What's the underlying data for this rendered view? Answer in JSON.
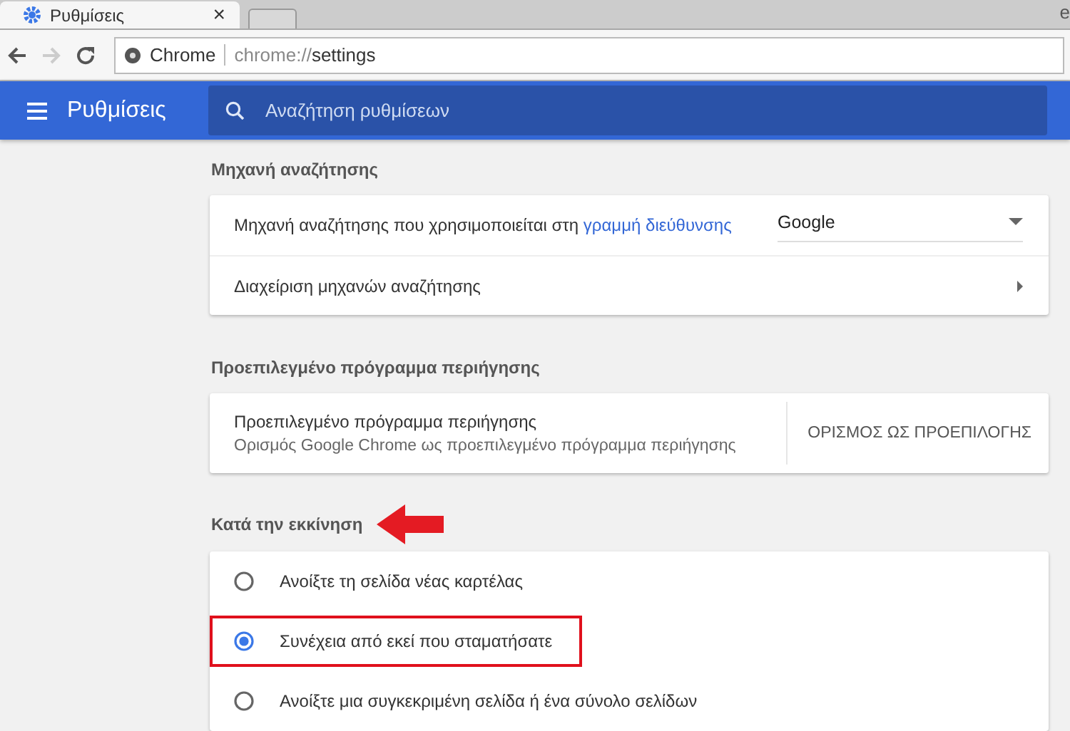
{
  "tabs": [
    {
      "title": "Ρυθμίσεις",
      "selected": true,
      "close": "×"
    },
    {
      "selected": false
    }
  ],
  "tabstrip_edge_text": "e",
  "address_bar": {
    "site": "Chrome",
    "url_scheme": "chrome://",
    "url_path": "settings"
  },
  "header": {
    "title": "Ρυθμίσεις",
    "search_placeholder": "Αναζήτηση ρυθμίσεων"
  },
  "sections": [
    {
      "title": "Μηχανή αναζήτησης",
      "arrow": false,
      "rows": [
        {
          "kind": "dropdown",
          "label": "Μηχανή αναζήτησης που χρησιμοποιείται στη ",
          "link": "γραμμή διεύθυνσης",
          "value": "Google"
        },
        {
          "kind": "link",
          "label": "Διαχείριση μηχανών αναζήτησης"
        }
      ]
    },
    {
      "title": "Προεπιλεγμένο πρόγραμμα περιήγησης",
      "arrow": false,
      "rows": [
        {
          "kind": "action",
          "label": "Προεπιλεγμένο πρόγραμμα περιήγησης",
          "sublabel": "Ορισμός Google Chrome ως προεπιλεγμένο πρόγραμμα περιήγησης",
          "button": "ΟΡΙΣΜΟΣ ΩΣ ΠΡΟΕΠΙΛΟΓΗΣ"
        }
      ]
    },
    {
      "title": "Κατά την εκκίνηση",
      "arrow": true,
      "rows": [
        {
          "kind": "radio",
          "label": "Ανοίξτε τη σελίδα νέας καρτέλας",
          "selected": false,
          "highlighted": false
        },
        {
          "kind": "radio",
          "label": "Συνέχεια από εκεί που σταματήσατε",
          "selected": true,
          "highlighted": true
        },
        {
          "kind": "radio",
          "label": "Ανοίξτε μια συγκεκριμένη σελίδα ή ένα σύνολο σελίδων",
          "selected": false,
          "highlighted": false
        }
      ]
    }
  ]
}
